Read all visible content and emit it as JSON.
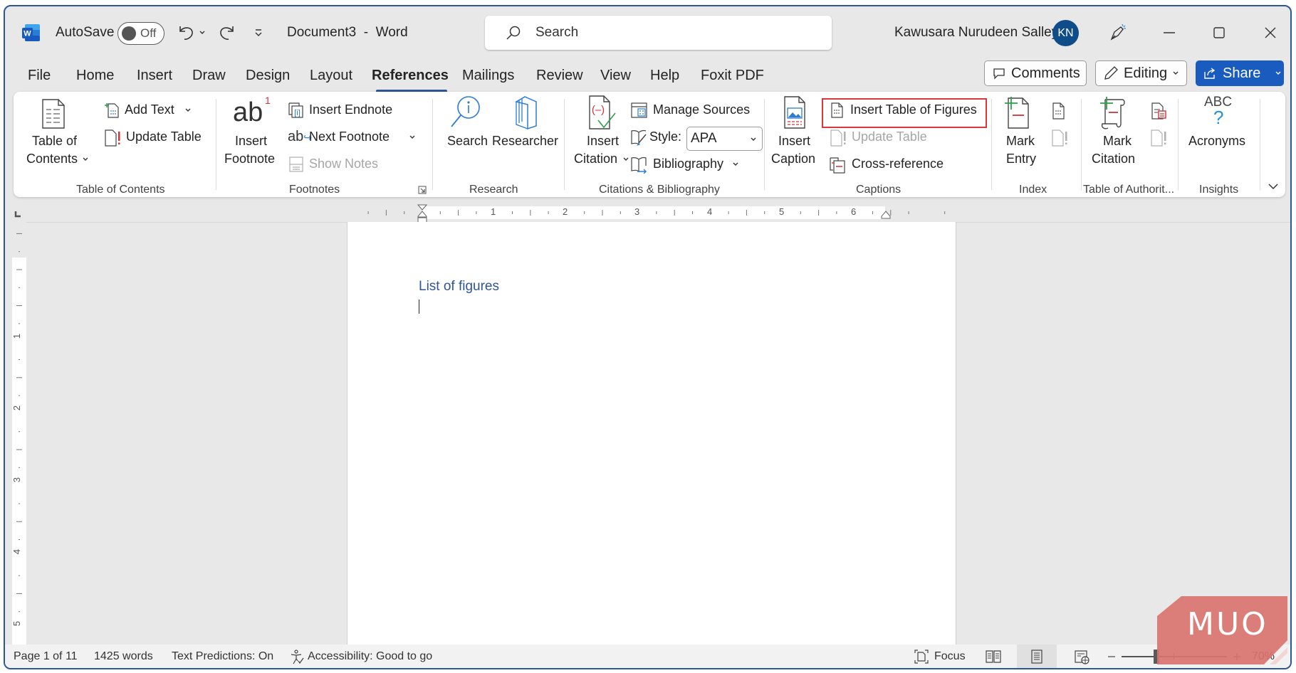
{
  "app": {
    "autosave_label": "AutoSave",
    "autosave_state": "Off",
    "document_title": "Document3  -  Word",
    "search_placeholder": "Search",
    "user_name": "Kawusara Nurudeen Salley",
    "user_initials": "KN"
  },
  "tabs": [
    {
      "label": "File"
    },
    {
      "label": "Home"
    },
    {
      "label": "Insert"
    },
    {
      "label": "Draw"
    },
    {
      "label": "Design"
    },
    {
      "label": "Layout"
    },
    {
      "label": "References",
      "active": true
    },
    {
      "label": "Mailings"
    },
    {
      "label": "Review"
    },
    {
      "label": "View"
    },
    {
      "label": "Help"
    },
    {
      "label": "Foxit PDF"
    }
  ],
  "header_buttons": {
    "comments": "Comments",
    "editing": "Editing",
    "share": "Share"
  },
  "ribbon": {
    "toc": {
      "label": "Table of Contents",
      "table_of_contents_1": "Table of",
      "table_of_contents_2": "Contents",
      "add_text": "Add Text",
      "update_table": "Update Table"
    },
    "footnotes": {
      "label": "Footnotes",
      "insert_footnote_1": "Insert",
      "insert_footnote_2": "Footnote",
      "insert_endnote": "Insert Endnote",
      "next_footnote": "Next Footnote",
      "show_notes": "Show Notes"
    },
    "research": {
      "label": "Research",
      "search": "Search",
      "researcher": "Researcher"
    },
    "citations": {
      "label": "Citations & Bibliography",
      "insert_citation_1": "Insert",
      "insert_citation_2": "Citation",
      "manage_sources": "Manage Sources",
      "style_label": "Style:",
      "style_value": "APA",
      "bibliography": "Bibliography"
    },
    "captions": {
      "label": "Captions",
      "insert_caption_1": "Insert",
      "insert_caption_2": "Caption",
      "insert_table_of_figures": "Insert Table of Figures",
      "update_table": "Update Table",
      "cross_reference": "Cross-reference"
    },
    "index": {
      "label": "Index",
      "mark_entry_1": "Mark",
      "mark_entry_2": "Entry"
    },
    "authorities": {
      "label": "Table of Authorit...",
      "mark_citation_1": "Mark",
      "mark_citation_2": "Citation"
    },
    "insights": {
      "label": "Insights",
      "acronyms_icon_text": "ABC",
      "acronyms": "Acronyms"
    }
  },
  "ruler": {
    "h_numbers": [
      "1",
      "2",
      "3",
      "4",
      "5",
      "6"
    ],
    "v_numbers": [
      "1",
      "2",
      "3",
      "4",
      "5"
    ]
  },
  "document": {
    "heading": "List of figures"
  },
  "status_bar": {
    "page": "Page 1 of 11",
    "words": "1425 words",
    "text_predictions": "Text Predictions: On",
    "accessibility": "Accessibility: Good to go",
    "focus": "Focus",
    "zoom": "70%",
    "zoom_percent": 70
  },
  "watermark": {
    "text": "MUO"
  },
  "colors": {
    "accent": "#2b5797",
    "share": "#1a5bbf",
    "highlight": "#d9363e",
    "heading": "#2f5597",
    "watermark": "#d9736e"
  }
}
